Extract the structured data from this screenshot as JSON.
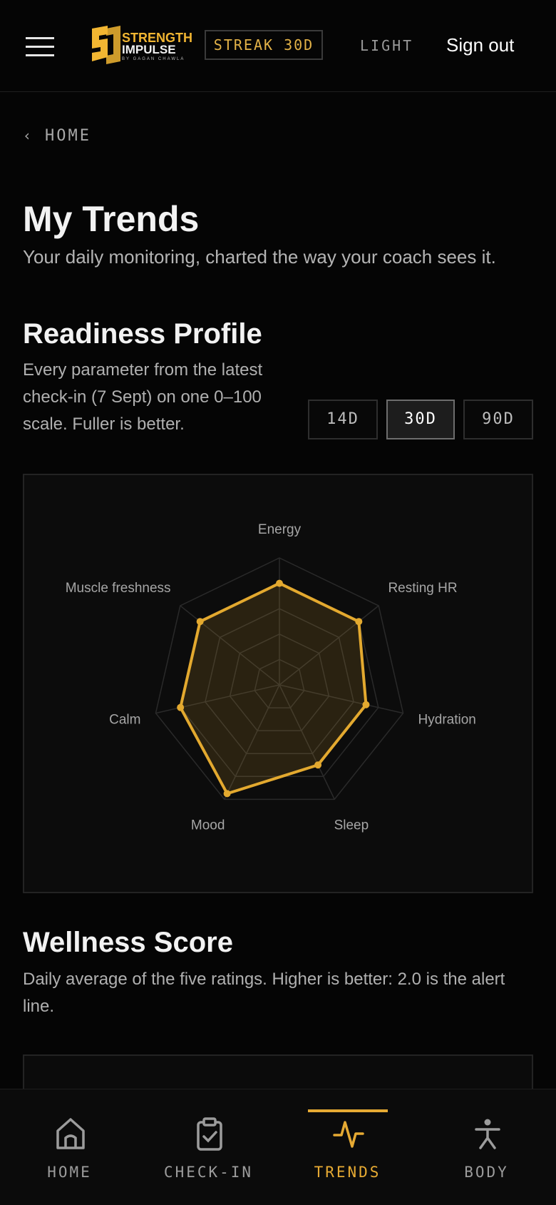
{
  "header": {
    "menu_icon": "hamburger-icon",
    "logo": {
      "mark": "SI",
      "line1": "STRENGTH",
      "line2": "IMPULSE",
      "tagline": "BY GAGAN CHAWLA"
    },
    "streak": "STREAK 30D",
    "theme_toggle": "LIGHT",
    "sign_out": "Sign out"
  },
  "breadcrumb": {
    "icon": "chevron-left-icon",
    "label": "HOME"
  },
  "page": {
    "title": "My Trends",
    "subtitle": "Your daily monitoring, charted the way your coach sees it."
  },
  "readiness": {
    "title": "Readiness Profile",
    "description": "Every parameter from the latest check-in (7 Sept) on one 0–100 scale. Fuller is better.",
    "ranges": [
      "14D",
      "30D",
      "90D"
    ],
    "selected_range": "30D"
  },
  "chart_data": {
    "type": "radar",
    "axes": [
      "Energy",
      "Resting HR",
      "Hydration",
      "Sleep",
      "Mood",
      "Calm",
      "Muscle freshness"
    ],
    "values": [
      80,
      80,
      70,
      70,
      95,
      80,
      80
    ],
    "range": [
      0,
      100
    ],
    "grid": true,
    "color": "#e3a92f"
  },
  "wellness": {
    "title": "Wellness Score",
    "description": "Daily average of the five ratings. Higher is better: 2.0 is the alert line."
  },
  "nav": {
    "items": [
      {
        "label": "HOME",
        "icon": "home-icon"
      },
      {
        "label": "CHECK-IN",
        "icon": "clipboard-check-icon"
      },
      {
        "label": "TRENDS",
        "icon": "activity-icon"
      },
      {
        "label": "BODY",
        "icon": "person-icon"
      }
    ],
    "active": "TRENDS"
  },
  "colors": {
    "accent": "#e3a92f",
    "background": "#050505",
    "card": "#0c0c0c"
  }
}
